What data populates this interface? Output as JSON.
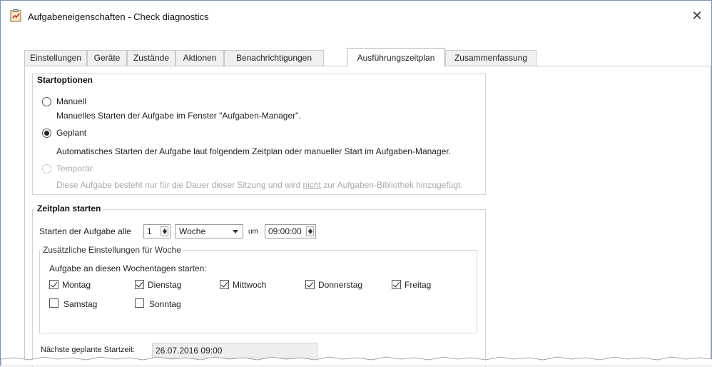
{
  "window": {
    "title": "Aufgabeneigenschaften - Check diagnostics",
    "close_glyph": "✕"
  },
  "tabs": [
    {
      "label": "Einstellungen",
      "active": false
    },
    {
      "label": "Geräte",
      "active": false
    },
    {
      "label": "Zustände",
      "active": false
    },
    {
      "label": "Aktionen",
      "active": false
    },
    {
      "label": "Benachrichtigungen",
      "active": false
    },
    {
      "label": "Ausführungszeitplan",
      "active": true
    },
    {
      "label": "Zusammenfassung",
      "active": false
    }
  ],
  "start_options": {
    "title": "Startoptionen",
    "manual": {
      "label": "Manuell",
      "description": "Manuelles Starten der Aufgabe im Fenster \"Aufgaben-Manager\".",
      "checked": false
    },
    "planned": {
      "label": "Geplant",
      "description": "Automatisches Starten der Aufgabe laut folgendem Zeitplan oder manueller Start im Aufgaben-Manager.",
      "checked": true
    },
    "temporary": {
      "label": "Temporär",
      "description_before": "Diese Aufgabe besteht nur für die Dauer dieser Sitzung und wird ",
      "description_emph": "nicht",
      "description_after": " zur Aufgaben-Bibliothek hinzugefügt.",
      "disabled": true
    }
  },
  "schedule": {
    "title": "Zeitplan starten",
    "start_label": "Starten der Aufgabe alle",
    "interval_value": "1",
    "unit_value": "Woche",
    "at_label": "um",
    "time_value": "09:00:00",
    "additional_title": "Zusätzliche Einstellungen für Woche",
    "weekdays_label": "Aufgabe an diesen Wochentagen starten:",
    "days": [
      {
        "label": "Montag",
        "checked": true
      },
      {
        "label": "Dienstag",
        "checked": true
      },
      {
        "label": "Mittwoch",
        "checked": true
      },
      {
        "label": "Donnerstag",
        "checked": true
      },
      {
        "label": "Freitag",
        "checked": true
      },
      {
        "label": "Samstag",
        "checked": false
      },
      {
        "label": "Sonntag",
        "checked": false
      }
    ],
    "next_start_label": "Nächste geplante Startzeit:",
    "next_start_value": "26.07.2016 09:00"
  },
  "colors": {
    "window_border": "#7a8fb0",
    "tab_inactive_bg": "#f0f0f0",
    "disabled_text": "#a9a9a9",
    "readonly_bg": "#eeeeee"
  },
  "icons": {
    "title_icon": "clipboard-task-icon",
    "close_icon": "close-icon"
  }
}
